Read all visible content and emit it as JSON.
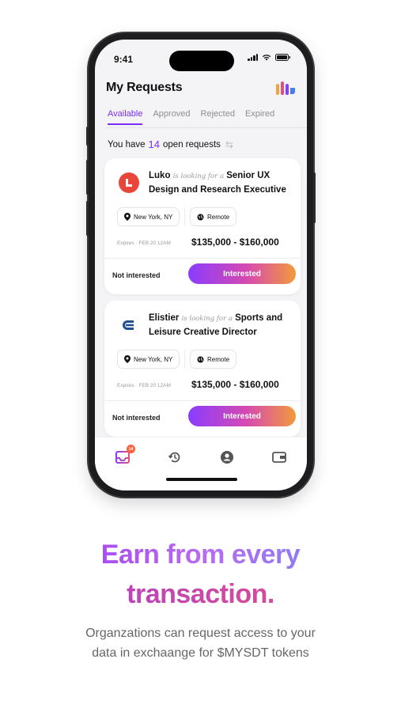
{
  "status": {
    "time": "9:41"
  },
  "app": {
    "title": "My Requests"
  },
  "tabs": [
    {
      "label": "Available",
      "active": true
    },
    {
      "label": "Approved",
      "active": false
    },
    {
      "label": "Rejected",
      "active": false
    },
    {
      "label": "Expired",
      "active": false
    }
  ],
  "summary": {
    "prefix": "You have",
    "count": "14",
    "suffix": "open requests"
  },
  "cards": [
    {
      "company": "Luko",
      "looking": "is looking for a",
      "role": "Senior UX Design and Research Executive",
      "location": "New York, NY",
      "mode": "Remote",
      "expires": "Expires · FEB 20 12AM",
      "salary": "$135,000 - $160,000",
      "decline_label": "Not interested",
      "accept_label": "Interested",
      "logo_color": "#e8463a"
    },
    {
      "company": "Elistier",
      "looking": "is looking for a",
      "role": "Sports and Leisure Creative Director",
      "location": "New York, NY",
      "mode": "Remote",
      "expires": "Expires · FEB 20 12AM",
      "salary": "$135,000 - $160,000",
      "decline_label": "Not interested",
      "accept_label": "Interested",
      "logo_color": "#1f4f8f"
    }
  ],
  "tabbar": {
    "items": [
      {
        "icon": "inbox-icon",
        "active": true,
        "badge": "14"
      },
      {
        "icon": "history-icon",
        "active": false
      },
      {
        "icon": "profile-icon",
        "active": false
      },
      {
        "icon": "wallet-icon",
        "active": false
      }
    ]
  },
  "marketing": {
    "headline_part1": "Earn from every",
    "headline_part2": "transaction.",
    "subtitle_line1": "Organzations can request access to your",
    "subtitle_line2": "data in exchaange for $MYSDT tokens"
  },
  "colors": {
    "accent": "#7b2ff7",
    "gradient_start": "#8a3cff",
    "gradient_end": "#f29a3a"
  }
}
